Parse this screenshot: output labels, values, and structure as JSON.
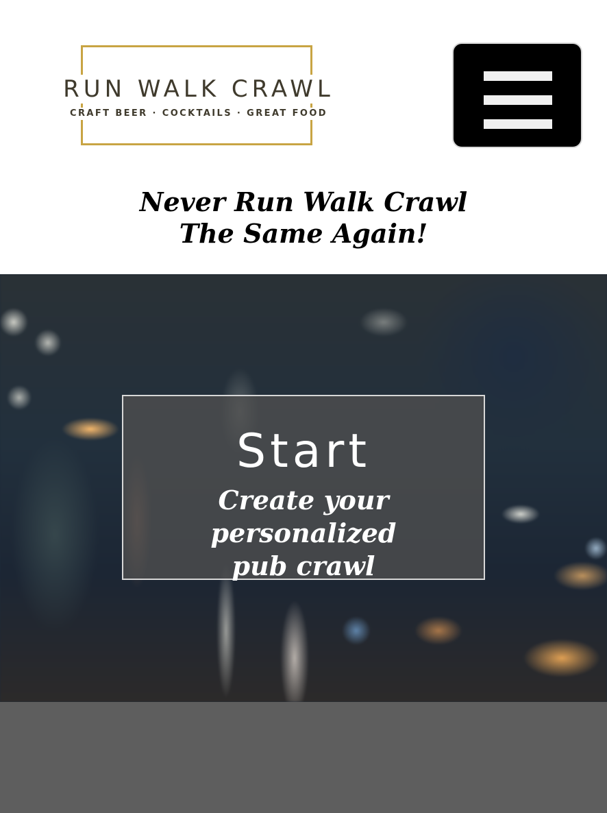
{
  "header": {
    "logo": {
      "title": "RUN WALK CRAWL",
      "subtitle": "CRAFT BEER · COCKTAILS · GREAT FOOD"
    },
    "menu_icon": "hamburger-menu-icon",
    "tagline_line1": "Never Run Walk Crawl",
    "tagline_line2": "The Same Again!"
  },
  "hero": {
    "card_title": "Start",
    "card_subtitle_line1": "Create your personalized",
    "card_subtitle_line2": "pub crawl"
  },
  "colors": {
    "logo_border": "#c8a443",
    "logo_text": "#3f3a2c",
    "menu_button_bg": "#000000",
    "menu_bars": "#f0f0f0",
    "card_bg": "#505050",
    "footer_band": "#5e5e5e"
  }
}
